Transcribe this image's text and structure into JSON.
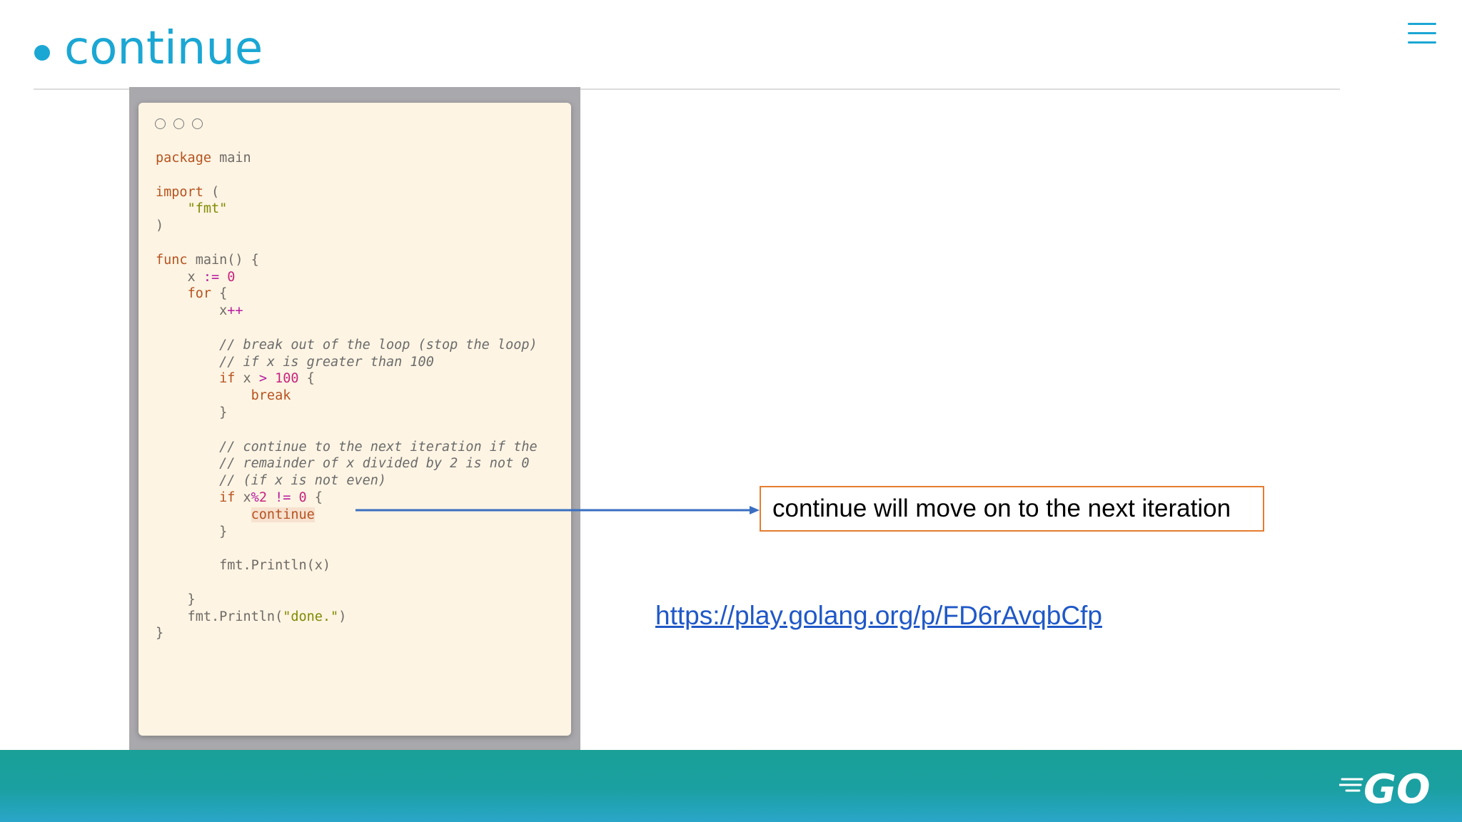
{
  "slide": {
    "title": "continue",
    "callout_text": "continue will move on to the next iteration",
    "link_text": "https://play.golang.org/p/FD6rAvqbCfp",
    "logo_text": "GO"
  },
  "code_lines": [
    [
      [
        "kw",
        "package"
      ],
      [
        "p",
        " main"
      ]
    ],
    [],
    [
      [
        "kw",
        "import"
      ],
      [
        "p",
        " ("
      ]
    ],
    [
      [
        "p",
        "    "
      ],
      [
        "str",
        "\"fmt\""
      ]
    ],
    [
      [
        "p",
        ")"
      ]
    ],
    [],
    [
      [
        "kw",
        "func"
      ],
      [
        "p",
        " main() {"
      ]
    ],
    [
      [
        "p",
        "    x "
      ],
      [
        "op",
        ":="
      ],
      [
        "p",
        " "
      ],
      [
        "num",
        "0"
      ]
    ],
    [
      [
        "p",
        "    "
      ],
      [
        "kw",
        "for"
      ],
      [
        "p",
        " {"
      ]
    ],
    [
      [
        "p",
        "        x"
      ],
      [
        "op",
        "++"
      ]
    ],
    [],
    [
      [
        "p",
        "        "
      ],
      [
        "cm",
        "// break out of the loop (stop the loop)"
      ]
    ],
    [
      [
        "p",
        "        "
      ],
      [
        "cm",
        "// if x is greater than 100"
      ]
    ],
    [
      [
        "p",
        "        "
      ],
      [
        "kw",
        "if"
      ],
      [
        "p",
        " x "
      ],
      [
        "op",
        ">"
      ],
      [
        "p",
        " "
      ],
      [
        "num",
        "100"
      ],
      [
        "p",
        " {"
      ]
    ],
    [
      [
        "p",
        "            "
      ],
      [
        "kw",
        "break"
      ]
    ],
    [
      [
        "p",
        "        }"
      ]
    ],
    [],
    [
      [
        "p",
        "        "
      ],
      [
        "cm",
        "// continue to the next iteration if the"
      ]
    ],
    [
      [
        "p",
        "        "
      ],
      [
        "cm",
        "// remainder of x divided by 2 is not 0"
      ]
    ],
    [
      [
        "p",
        "        "
      ],
      [
        "cm",
        "// (if x is not even)"
      ]
    ],
    [
      [
        "p",
        "        "
      ],
      [
        "kw",
        "if"
      ],
      [
        "p",
        " x"
      ],
      [
        "op",
        "%"
      ],
      [
        "num",
        "2"
      ],
      [
        "p",
        " "
      ],
      [
        "op",
        "!="
      ],
      [
        "p",
        " "
      ],
      [
        "num",
        "0"
      ],
      [
        "p",
        " {"
      ]
    ],
    [
      [
        "p",
        "            "
      ],
      [
        "kwhl",
        "continue"
      ]
    ],
    [
      [
        "p",
        "        }"
      ]
    ],
    [],
    [
      [
        "p",
        "        fmt.Println(x)"
      ]
    ],
    [],
    [
      [
        "p",
        "    }"
      ]
    ],
    [
      [
        "p",
        "    fmt.Println("
      ],
      [
        "str",
        "\"done.\""
      ],
      [
        "p",
        ")"
      ]
    ],
    [
      [
        "p",
        "}"
      ]
    ]
  ],
  "colors": {
    "accent": "#1ba7d4",
    "callout_border": "#e57d30",
    "arrow": "#3a6ec1",
    "link": "#1f58c7",
    "footer": "#1aa097"
  },
  "icons": [
    "menu-icon",
    "window-dots-icon",
    "go-logo-icon"
  ]
}
